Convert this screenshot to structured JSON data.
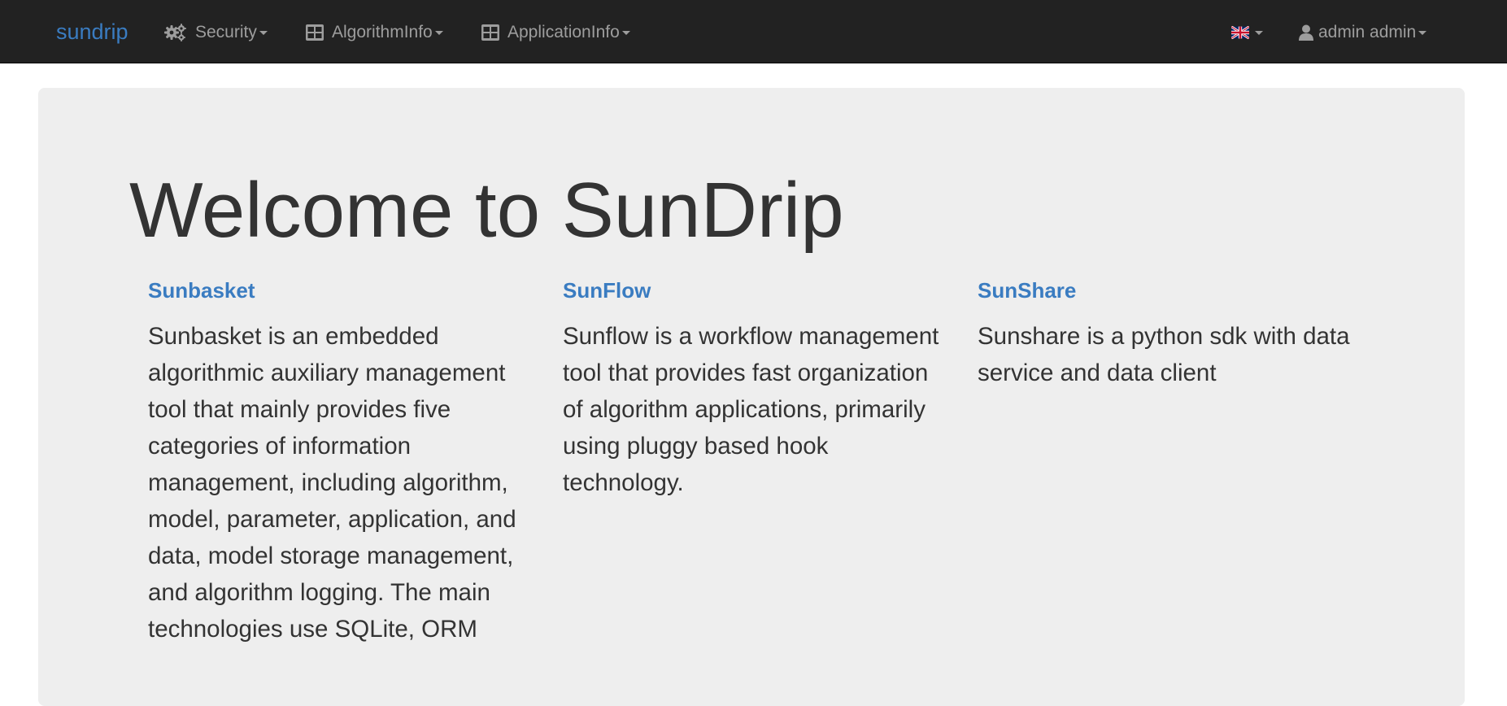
{
  "navbar": {
    "brand": "sundrip",
    "menus": [
      {
        "label": "Security",
        "icon": "gears-icon"
      },
      {
        "label": "AlgorithmInfo",
        "icon": "table-icon"
      },
      {
        "label": "ApplicationInfo",
        "icon": "table-icon"
      }
    ],
    "language_icon": "uk-flag-icon",
    "user": {
      "label": "admin admin",
      "icon": "user-icon"
    }
  },
  "main": {
    "title": "Welcome to SunDrip",
    "columns": [
      {
        "heading": "Sunbasket",
        "text": "Sunbasket is an embedded algorithmic auxiliary management tool that mainly provides five categories of information management, including algorithm, model, parameter, application, and data, model storage management, and algorithm logging. The main technologies use SQLite, ORM"
      },
      {
        "heading": "SunFlow",
        "text": "Sunflow is a workflow management tool that provides fast organization of algorithm applications, primarily using pluggy based hook technology."
      },
      {
        "heading": "SunShare",
        "text": "Sunshare is a python sdk with data service and data client"
      }
    ]
  },
  "colors": {
    "navbar_bg": "#222222",
    "brand": "#3a7cc1",
    "nav_text": "#9d9d9d",
    "jumbotron_bg": "#eeeeee",
    "link": "#3a7cc1",
    "body_text": "#333333"
  }
}
